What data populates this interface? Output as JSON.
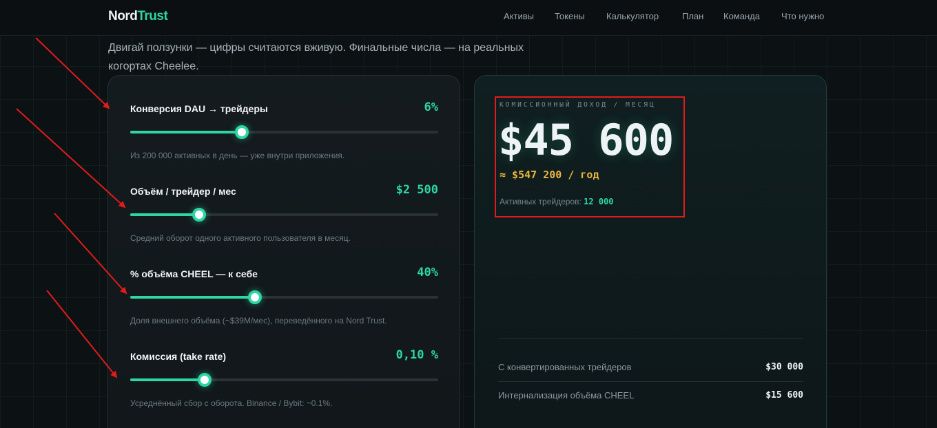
{
  "header": {
    "logo_part1": "Nord",
    "logo_part2": "Trust",
    "nav": [
      "Активы",
      "Токены",
      "Калькулятор",
      "План",
      "Команда",
      "Что нужно"
    ]
  },
  "intro": {
    "line1": "Двигай ползунки — цифры считаются вживую. Финальные числа — на реальных",
    "line2": "когортах Cheelee."
  },
  "sliders": [
    {
      "label": "Конверсия DAU → трейдеры",
      "value": "6%",
      "hint": "Из 200 000 активных в день — уже внутри приложения.",
      "level": 0.363
    },
    {
      "label": "Объём / трейдер / мес",
      "value": "$2 500",
      "hint": "Средний оборот одного активного пользователя в месяц.",
      "level": 0.224
    },
    {
      "label": "% объёма CHEEL — к себе",
      "value": "40%",
      "hint": "Доля внешнего объёма (~$39M/мес), переведённого на Nord Trust.",
      "level": 0.404
    },
    {
      "label": "Комиссия (take rate)",
      "value": "0,10 %",
      "hint": "Усреднённый сбор с оборота. Binance / Bybit: ~0.1%.",
      "level": 0.242
    }
  ],
  "revenue": {
    "caption": "КОМИССИОННЫЙ ДОХОД / МЕСЯЦ",
    "amount": "$45 600",
    "per_year": "≈ $547 200 / год",
    "traders_label": "Активных трейдеров:",
    "traders_value": "12 000"
  },
  "breakdown": [
    {
      "label": "С конвертированных трейдеров",
      "value": "$30 000"
    },
    {
      "label": "Интернализация объёма CHEEL",
      "value": "$15 600"
    }
  ],
  "colors": {
    "accent": "#2ed6a3",
    "gold": "#e9b53c",
    "highlight_box": "#e01b1b",
    "arrow": "#e01b1b"
  }
}
